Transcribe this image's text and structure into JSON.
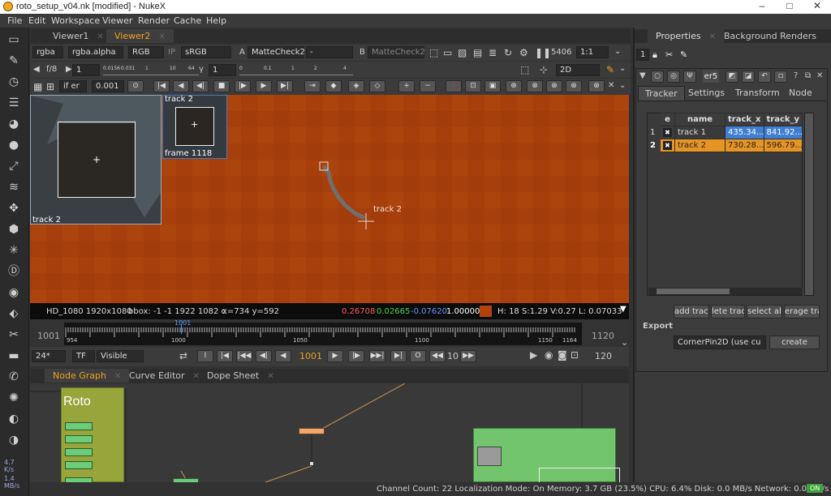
{
  "window": {
    "title": "roto_setup_v04.nk [modified] - NukeX",
    "minimize": "–",
    "maximize": "□",
    "close": "✕"
  },
  "menubar": [
    "File",
    "Edit",
    "Workspace",
    "Viewer",
    "Render",
    "Cache",
    "Help"
  ],
  "viewer_tabs": [
    {
      "label": "Viewer1",
      "active": false
    },
    {
      "label": "Viewer2",
      "active": true
    }
  ],
  "viewer_toolbar": {
    "channels": "rgba",
    "alpha": "rgba.alpha",
    "display": "RGB",
    "ip": "IP",
    "lut": "sRGB",
    "a_label": "A",
    "a_input": "MatteCheck2",
    "wipe": "-",
    "b_label": "B",
    "b_input": "MatteCheck2",
    "frame_value": "5406",
    "zoom": "1:1",
    "fstop": "f/8",
    "gain": "1",
    "gamma_label": "γ",
    "gamma": "1",
    "view_mode": "2D",
    "gain_ticks": [
      "1",
      "0.0156",
      "0.031",
      "1",
      "10",
      "64"
    ],
    "gamma_ticks": [
      "0",
      "0.1",
      "1",
      "2",
      "4"
    ]
  },
  "tracker_toolbar": {
    "filter": "if er",
    "step": "0.001"
  },
  "viewer": {
    "zoom_label": "track 2",
    "pattern_label": "track 2",
    "pattern_frame": "frame 1118",
    "track_label": "track 2"
  },
  "infobar": {
    "format": "HD_1080 1920x1080",
    "bbox": "bbox: -1 -1 1922 1082 c",
    "xy": "x=734 y=592",
    "r": "0.26708",
    "g": "0.02665",
    "b": "-0.07620",
    "a": "1.00000",
    "swatch_color": "#b2410c",
    "hsv": "H: 18 S:1.29 V:0.27",
    "l": "L: 0.07033"
  },
  "timeline": {
    "start": "1001",
    "end": "1120",
    "current": "1001",
    "labels": [
      "954",
      "1000",
      "1050",
      "1100",
      "1150",
      "1164"
    ]
  },
  "playbar": {
    "fps": "24*",
    "tf": "TF",
    "visible": "Visible",
    "frame": "1001",
    "increment": "10",
    "end": "120"
  },
  "nodegraph_tabs": [
    {
      "label": "Node Graph",
      "active": true
    },
    {
      "label": "Curve Editor",
      "active": false
    },
    {
      "label": "Dope Sheet",
      "active": false
    }
  ],
  "nodegraph": {
    "backdrop_label": "Roto"
  },
  "left_stats": {
    "cpu": "4.7",
    "cpu_unit": "K/s",
    "mem": "1.4",
    "mem_unit": "MB/s"
  },
  "statusbar": {
    "text": "Channel Count: 22  Localization Mode: On  Memory: 3.7 GB (23.5%)  CPU: 6.4%  Disk: 0.0 MB/s  Network: 0.0 MB/s",
    "badge": "ON"
  },
  "properties": {
    "tabs": [
      {
        "label": "Properties",
        "active": true
      },
      {
        "label": "Background Renders",
        "active": false
      }
    ],
    "max_panels": "1",
    "node_name": "er5",
    "panel_tabs": [
      "Tracker",
      "Settings",
      "Transform",
      "Node"
    ],
    "table_headers": [
      "e",
      "name",
      "track_x",
      "track_y"
    ],
    "tracks": [
      {
        "index": "1",
        "name": "track 1",
        "x": "435.34...",
        "y": "841.92..."
      },
      {
        "index": "2",
        "name": "track 2",
        "x": "730.28...",
        "y": "596.79..."
      }
    ],
    "buttons": [
      "add track",
      "lete trac",
      "select all",
      "erage tra"
    ],
    "export_label": "Export",
    "export_dropdown": "CornerPin2D (use cu",
    "create_label": "create",
    "help": "?"
  },
  "colors": {
    "accent": "#f0a020",
    "viewer_bg": "#a9410b",
    "track1_sel": "#3f7fd1",
    "track2_sel": "#e69424",
    "backdrop": "#98a53a",
    "backdrop_green": "#72c56c"
  }
}
